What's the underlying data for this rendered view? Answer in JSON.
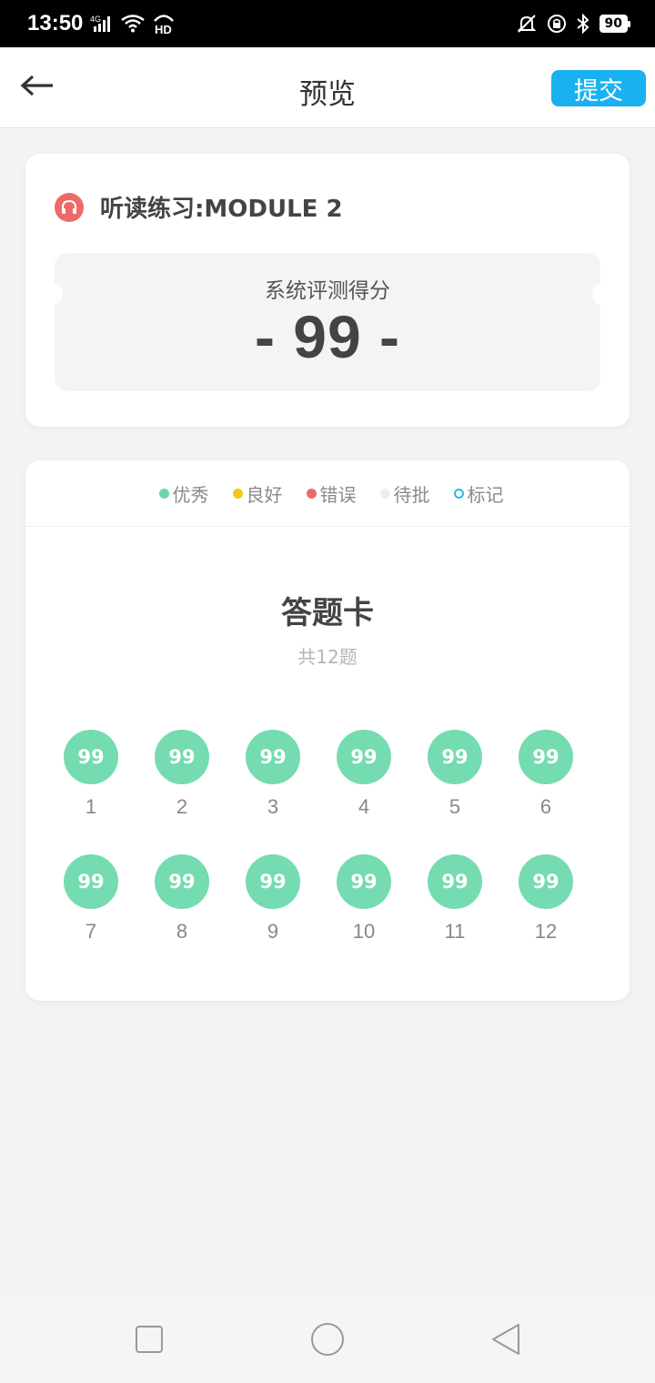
{
  "status_bar": {
    "time": "13:50",
    "network": "4G",
    "hd_label": "HD",
    "battery": "90"
  },
  "header": {
    "title": "预览",
    "submit_label": "提交"
  },
  "score_card": {
    "title": "听读练习:MODULE 2",
    "score_label": "系统评测得分",
    "score_value": "- 99 -"
  },
  "legend": [
    {
      "label": "优秀",
      "color": "#6fd6a9",
      "hollow": false
    },
    {
      "label": "良好",
      "color": "#f5c518",
      "hollow": false
    },
    {
      "label": "错误",
      "color": "#ee6a6a",
      "hollow": false
    },
    {
      "label": "待批",
      "color": "#eeeeee",
      "hollow": false
    },
    {
      "label": "标记",
      "color": "#2db7e8",
      "hollow": true
    }
  ],
  "answer_card": {
    "title": "答题卡",
    "count": "共12题",
    "questions": [
      {
        "num": "1",
        "score": "99"
      },
      {
        "num": "2",
        "score": "99"
      },
      {
        "num": "3",
        "score": "99"
      },
      {
        "num": "4",
        "score": "99"
      },
      {
        "num": "5",
        "score": "99"
      },
      {
        "num": "6",
        "score": "99"
      },
      {
        "num": "7",
        "score": "99"
      },
      {
        "num": "8",
        "score": "99"
      },
      {
        "num": "9",
        "score": "99"
      },
      {
        "num": "10",
        "score": "99"
      },
      {
        "num": "11",
        "score": "99"
      },
      {
        "num": "12",
        "score": "99"
      }
    ]
  },
  "colors": {
    "accent": "#1ab1f0",
    "excellent": "#75dbb0",
    "headphone": "#ee6a6a"
  },
  "icons": {
    "back": "arrow-left-icon",
    "headphone": "headphone-icon",
    "nav_recent": "square-icon",
    "nav_home": "circle-icon",
    "nav_back": "triangle-back-icon"
  }
}
